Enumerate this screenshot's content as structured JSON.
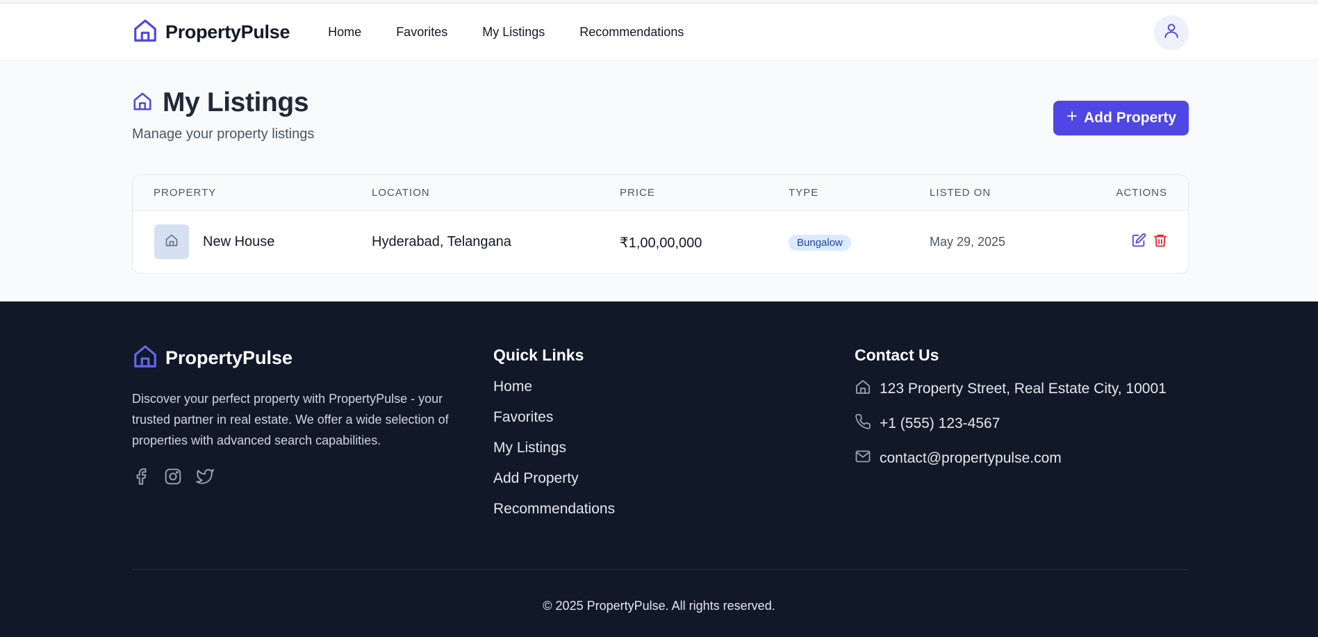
{
  "app": {
    "brand": "PropertyPulse",
    "accent": "#4f46e5",
    "danger": "#dc2626"
  },
  "nav": {
    "items": [
      "Home",
      "Favorites",
      "My Listings",
      "Recommendations"
    ]
  },
  "page": {
    "title": "My Listings",
    "subtitle": "Manage your property listings",
    "add_button": "Add Property"
  },
  "table": {
    "headers": [
      "PROPERTY",
      "LOCATION",
      "PRICE",
      "TYPE",
      "LISTED ON",
      "ACTIONS"
    ],
    "rows": [
      {
        "name": "New House",
        "location": "Hyderabad, Telangana",
        "price": "₹1,00,00,000",
        "type": "Bungalow",
        "listed_on": "May 29, 2025",
        "actions": [
          "edit-icon",
          "trash-icon"
        ]
      }
    ]
  },
  "footer": {
    "brand": "PropertyPulse",
    "description": "Discover your perfect property with PropertyPulse - your trusted partner in real estate. We offer a wide selection of properties with advanced search capabilities.",
    "socials": [
      "facebook-icon",
      "instagram-icon",
      "twitter-icon"
    ],
    "quick_links_title": "Quick Links",
    "quick_links": [
      "Home",
      "Favorites",
      "My Listings",
      "Add Property",
      "Recommendations"
    ],
    "contact_title": "Contact Us",
    "contact": {
      "address": "123 Property Street, Real Estate City, 10001",
      "phone": "+1 (555) 123-4567",
      "email": "contact@propertypulse.com"
    },
    "copyright": "© 2025 PropertyPulse. All rights reserved."
  }
}
